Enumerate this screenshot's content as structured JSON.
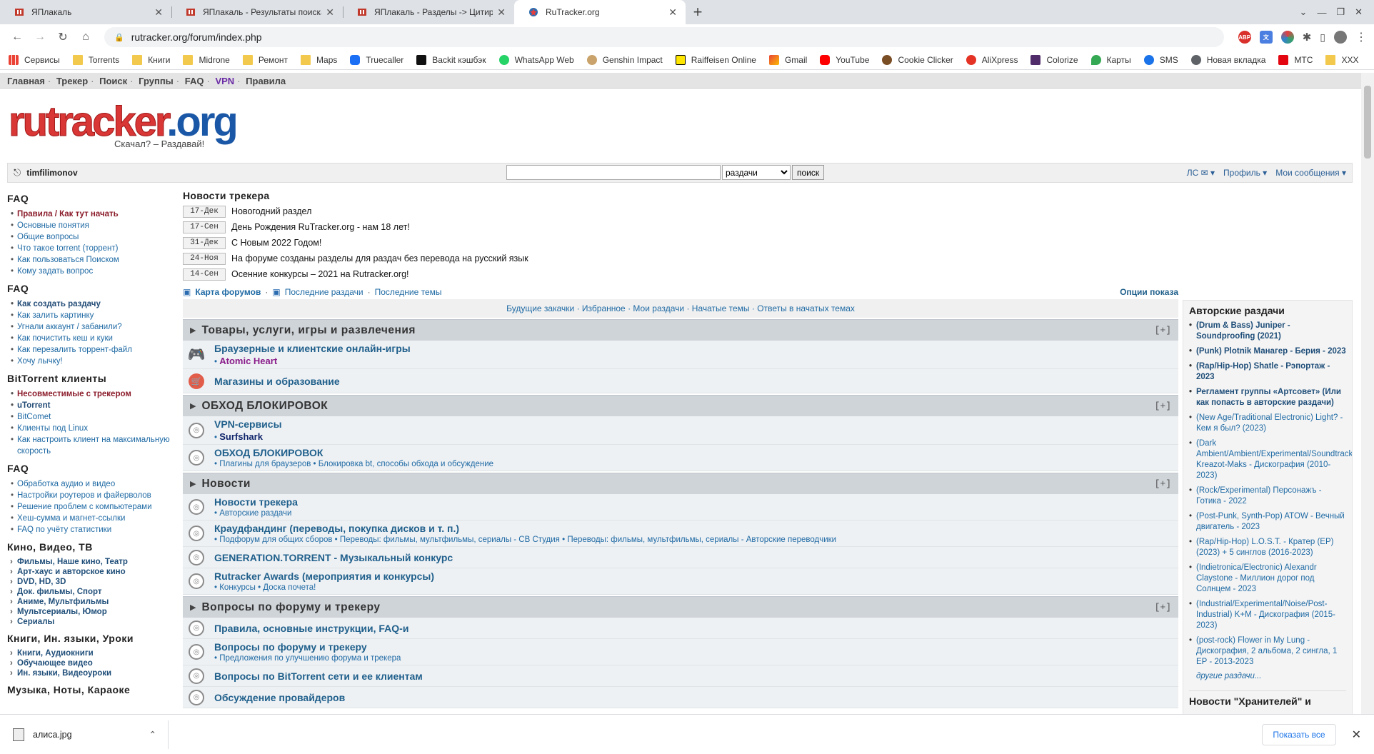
{
  "tabs": [
    {
      "title": "ЯПлакаль",
      "active": false
    },
    {
      "title": "ЯПлакаль - Результаты поиска",
      "active": false
    },
    {
      "title": "ЯПлакаль - Разделы -> Цитируем",
      "active": false
    },
    {
      "title": "RuTracker.org",
      "active": true
    }
  ],
  "address": "rutracker.org/forum/index.php",
  "bookmarks": [
    "Сервисы",
    "Torrents",
    "Книги",
    "Midrone",
    "Ремонт",
    "Maps",
    "Truecaller",
    "Backit кэшбэк",
    "WhatsApp Web",
    "Genshin Impact",
    "Raiffeisen Online",
    "Gmail",
    "YouTube",
    "Cookie Clicker",
    "AliXpress",
    "Colorize",
    "Карты",
    "SMS",
    "Новая вкладка",
    "МТС",
    "XXX"
  ],
  "topnav": {
    "home": "Главная",
    "tracker": "Трекер",
    "search": "Поиск",
    "groups": "Группы",
    "faq": "FAQ",
    "vpn": "VPN",
    "rules": "Правила"
  },
  "logo": {
    "word1": "rutracker",
    "word2": ".org",
    "slogan": "Скачал? – Раздавай!"
  },
  "userbar": {
    "username": "timfilimonov",
    "search_option": "раздачи",
    "search_button": "поиск",
    "pm": "ЛС ✉ ▾",
    "profile": "Профиль ▾",
    "my_messages": "Мои сообщения ▾"
  },
  "left": {
    "faq1_title": "FAQ",
    "faq1": [
      "Правила / Как тут начать",
      "Основные понятия",
      "Общие вопросы",
      "Что такое torrent (торрент)",
      "Как пользоваться Поиском",
      "Кому задать вопрос"
    ],
    "faq2_title": "FAQ",
    "faq2": [
      "Как создать раздачу",
      "Как залить картинку",
      "Угнали аккаунт / забанили?",
      "Как почистить кеш и куки",
      "Как перезалить торрент-файл",
      "Хочу лычку!"
    ],
    "bt_title": "BitTorrent клиенты",
    "bt": [
      "Несовместимые с трекером",
      "uTorrent",
      "BitComet",
      "Клиенты под Linux",
      "Как настроить клиент на максимальную скорость"
    ],
    "faq3_title": "FAQ",
    "faq3": [
      "Обработка аудио и видео",
      "Настройки роутеров и файерволов",
      "Решение проблем с компьютерами",
      "Хеш-сумма и магнет-ссылки",
      "FAQ по учёту статистики"
    ],
    "kino_title": "Кино, Видео, ТВ",
    "kino": [
      "Фильмы, Наше кино, Театр",
      "Арт-хаус и авторское кино",
      "DVD, HD, 3D",
      "Док. фильмы, Спорт",
      "Аниме, Мультфильмы",
      "Мультсериалы, Юмор",
      "Сериалы"
    ],
    "books_title": "Книги, Ин. языки, Уроки",
    "books": [
      "Книги, Аудиокниги",
      "Обучающее видео",
      "Ин. языки, Видеоуроки"
    ],
    "music_title": "Музыка, Ноты, Караоке"
  },
  "news": {
    "title": "Новости трекера",
    "items": [
      {
        "date": "17-Дек",
        "text": "Новогодний раздел"
      },
      {
        "date": "17-Сен",
        "text": "День Рождения RuTracker.org - нам 18 лет!"
      },
      {
        "date": "31-Дек",
        "text": "С Новым 2022 Годом!"
      },
      {
        "date": "24-Ноя",
        "text": "На форуме созданы разделы для раздач без перевода на русский язык"
      },
      {
        "date": "14-Сен",
        "text": "Осенние конкурсы – 2021 на Rutracker.org!"
      }
    ]
  },
  "maplinks": {
    "map": "Карта форумов",
    "recent": "Последние раздачи",
    "topics": "Последние темы",
    "options": "Опции показа"
  },
  "subbar": [
    "Будущие закачки",
    "Избранное",
    "Мои раздачи",
    "Начатые темы",
    "Ответы в начатых темах"
  ],
  "categories": [
    {
      "name": "Товары, услуги, игры и развлечения",
      "expand": "[+]",
      "forums": [
        {
          "name": "Браузерные и клиентские онлайн-игры",
          "sub": "Atomic Heart",
          "icon": "gamepad-icon"
        },
        {
          "name": "Магазины и образование",
          "sub": "",
          "icon": "shop-icon"
        }
      ]
    },
    {
      "name": "ОБХОД БЛОКИРОВОК",
      "expand": "[+]",
      "forums": [
        {
          "name": "VPN-сервисы",
          "sub": "Surfshark",
          "icon": "forum-icon"
        },
        {
          "name": "ОБХОД БЛОКИРОВОК",
          "sub": "Плагины для браузеров • Блокировка bt, способы обхода и обсуждение",
          "icon": "forum-icon"
        }
      ]
    },
    {
      "name": "Новости",
      "expand": "[+]",
      "forums": [
        {
          "name": "Новости трекера",
          "sub": "Авторские раздачи",
          "icon": "forum-icon"
        },
        {
          "name": "Краудфандинг (переводы, покупка дисков и т. п.)",
          "sub": "Подфорум для общих сборов • Переводы: фильмы, мультфильмы, сериалы - СВ Студия • Переводы: фильмы, мультфильмы, сериалы - Авторские переводчики",
          "icon": "forum-icon"
        },
        {
          "name": "GENERATION.TORRENT - Музыкальный конкурс",
          "sub": "",
          "icon": "forum-icon"
        },
        {
          "name": "Rutracker Awards (мероприятия и конкурсы)",
          "sub": "Конкурсы • Доска почета!",
          "icon": "forum-icon"
        }
      ]
    },
    {
      "name": "Вопросы по форуму и трекеру",
      "expand": "[+]",
      "forums": [
        {
          "name": "Правила, основные инструкции, FAQ-и",
          "sub": "",
          "icon": "forum-icon"
        },
        {
          "name": "Вопросы по форуму и трекеру",
          "sub": "Предложения по улучшению форума и трекера",
          "icon": "forum-icon"
        },
        {
          "name": "Вопросы по BitTorrent сети и ее клиентам",
          "sub": "",
          "icon": "forum-icon"
        },
        {
          "name": "Обсуждение провайдеров",
          "sub": "",
          "icon": "forum-icon"
        }
      ]
    }
  ],
  "right": {
    "title": "Авторские раздачи",
    "items_bold": [
      "(Drum & Bass) Juniper - Soundproofing (2021)",
      "(Punk) Plotnik Манагер - Берия - 2023",
      "(Rap/Hip-Hop) Shatle - Рэпортаж - 2023",
      "Регламент группы «Артсовет» (Или как попасть в авторские раздачи)"
    ],
    "items": [
      "(New Age/Traditional Electronic) Light? - Кем я был? (2023)",
      "(Dark Ambient/Ambient/Experimental/Soundtrack) Kreazot-Maks - Дискография (2010-2023)",
      "(Rock/Experimental) Персонажъ - Готика - 2022",
      "(Post-Punk, Synth-Pop) ATOW - Вечный двигатель - 2023",
      "(Rap/Hip-Hop) L.O.S.T. - Кратер (EP) (2023) + 5 синглов (2016-2023)",
      "(Indietronica/Electronic) Alexandr Claystone - Миллион дорог под Солнцем - 2023",
      "(Industrial/Experimental/Noise/Post-Industrial) K+M - Дискография (2015-2023)",
      "(post-rock) Flower in My Lung - Дискография, 2 альбома, 2 сингла, 1 EP - 2013-2023"
    ],
    "more": "другие раздачи...",
    "title2": "Новости \"Хранителей\" и"
  },
  "download": {
    "file": "алиса.jpg",
    "show_all": "Показать все"
  },
  "colors": {
    "accent": "#1f6aa4",
    "cat_bg": "#cfd4d9",
    "logo_red": "#d93636"
  }
}
